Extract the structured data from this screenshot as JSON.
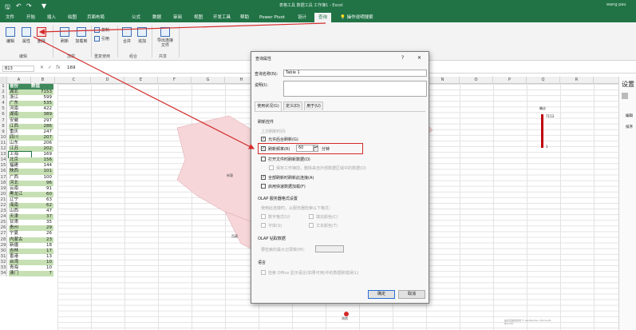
{
  "titlebar": {
    "qa_icons": [
      "save-icon",
      "undo-icon",
      "redo-icon",
      "filter-icon"
    ],
    "window_title": "表格工具   数据工具   工作簿1 - Excel",
    "user": "wang pau"
  },
  "tabs": [
    "文件",
    "开始",
    "插入",
    "绘图",
    "页面布局",
    "公式",
    "数据",
    "审阅",
    "视图",
    "开发工具",
    "帮助",
    "Power Pivot",
    "设计",
    "查询"
  ],
  "selected_tab": "查询",
  "tell_me": "操作说明搜索",
  "ribbon": {
    "buttons": [
      "编辑",
      "属性",
      "删除",
      "刷新",
      "加载到",
      "合并",
      "追加",
      "导出连接文件"
    ],
    "small_buttons": [
      "复制",
      "引用"
    ],
    "groups": [
      "编辑",
      "加载",
      "重复使用",
      "组合",
      "共享"
    ]
  },
  "formula_bar": {
    "name_box": "B13",
    "value": "169"
  },
  "columns": [
    "A",
    "B",
    "C",
    "D",
    "E",
    "F",
    "G",
    "H",
    "I",
    "J",
    "K",
    "L",
    "M",
    "N",
    "O",
    "P",
    "Q",
    "R"
  ],
  "sheet": {
    "header": [
      "省份",
      "数值"
    ],
    "rows": [
      [
        "湖北",
        "7153"
      ],
      [
        "浙江",
        "599"
      ],
      [
        "广东",
        "535"
      ],
      [
        "河南",
        "422"
      ],
      [
        "湖南",
        "389"
      ],
      [
        "安徽",
        "297"
      ],
      [
        "江西",
        "286"
      ],
      [
        "重庆",
        "247"
      ],
      [
        "四川",
        "207"
      ],
      [
        "山东",
        "206"
      ],
      [
        "江苏",
        "202"
      ],
      [
        "上海",
        "169"
      ],
      [
        "北京",
        "156"
      ],
      [
        "福建",
        "144"
      ],
      [
        "陕西",
        "101"
      ],
      [
        "广西",
        "100"
      ],
      [
        "河北",
        "96"
      ],
      [
        "云南",
        "91"
      ],
      [
        "黑龙江",
        "60"
      ],
      [
        "辽宁",
        "63"
      ],
      [
        "海南",
        "62"
      ],
      [
        "山西",
        "47"
      ],
      [
        "天津",
        "37"
      ],
      [
        "甘肃",
        "35"
      ],
      [
        "贵州",
        "29"
      ],
      [
        "宁夏",
        "26"
      ],
      [
        "内蒙古",
        "23"
      ],
      [
        "新疆",
        "18"
      ],
      [
        "吉林",
        "17"
      ],
      [
        "香港",
        "13"
      ],
      [
        "台湾",
        "10"
      ],
      [
        "青海",
        "10"
      ],
      [
        "澳门",
        "7"
      ]
    ]
  },
  "map": {
    "legend_title": "确诊",
    "legend_max": "7153",
    "legend_min": "1",
    "labels": [
      "新疆",
      "西藏",
      "海南"
    ],
    "credit": "由必应提供支持 © GeoNames, Microsoft, Navinfo"
  },
  "side_pane": {
    "title": "设置",
    "items": [
      "编辑",
      "排序"
    ]
  },
  "dialog": {
    "title": "查询属性",
    "help": "?",
    "close": "✕",
    "name_label": "查询名称(N):",
    "name_value": "Table 1",
    "desc_label": "说明(I):",
    "tabs": [
      "使用状况(G)",
      "定义(D)",
      "用于(U)"
    ],
    "refresh_section": "刷新控件",
    "last_refresh": "上次刷新时间:",
    "opt_background": "允许后台刷新(G)",
    "opt_every": "刷新频率(R)",
    "every_value": "60",
    "minutes": "分钟",
    "opt_on_open": "打开文件时刷新数据(O)",
    "opt_remove": "保存工作簿前，删除来自外部数据区域中的数据(D)",
    "opt_refresh_all": "全部刷新时刷新此连接(A)",
    "opt_fast_load": "启用快速数据加载(F)",
    "olap_section": "OLAP 服务器格式设置",
    "olap_hint": "使用此连接时，从服务器检索以下格式：",
    "olap_items": [
      "数字格式(U)",
      "填充颜色(C)",
      "字体(S)",
      "文本颜色(T)"
    ],
    "drill_section": "OLAP 钻取数据",
    "drill_label": "要检索的最大记录数(M):",
    "lang_section": "语言",
    "lang_opt": "检索 Office 显示语言(如果可用)中的数据和错误(L)",
    "ok": "确定",
    "cancel": "取消",
    "checks": {
      "background": true,
      "every": true,
      "on_open": false,
      "remove": false,
      "refresh_all": true,
      "fast_load": false
    }
  },
  "colors": {
    "accent": "#217346",
    "annotation": "#d42a2a",
    "map_fill": "#f6d6d9",
    "legend_red": "#c00010"
  }
}
